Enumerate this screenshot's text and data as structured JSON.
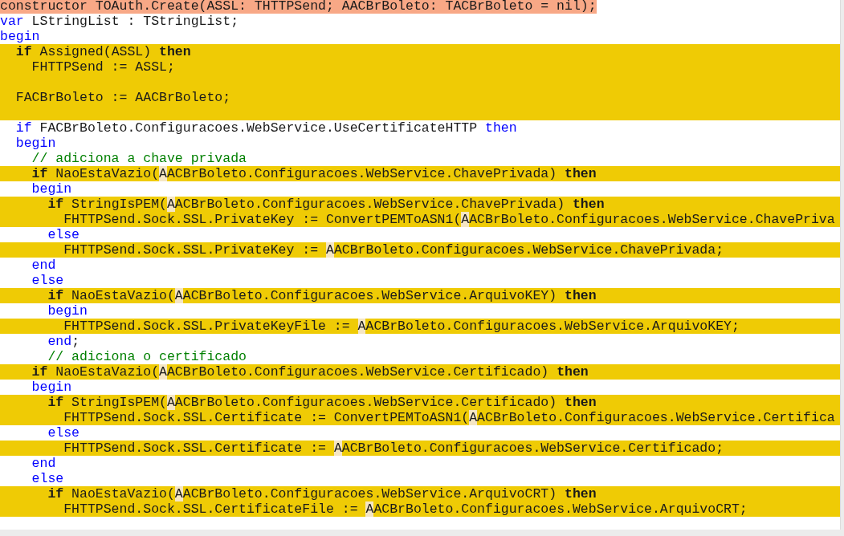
{
  "code_lines": [
    {
      "kind": "changed",
      "segments": [
        {
          "kind": "text",
          "text": "constructor TOAuth.Create(ASSL: THTTPSend; AACBrBoleto: TACBrBoleto = nil);"
        }
      ]
    },
    {
      "kind": "plain",
      "segments": [
        {
          "kind": "keyword",
          "text": "var"
        },
        {
          "kind": "text",
          "text": " LStringList : TStringList;"
        }
      ]
    },
    {
      "kind": "plain",
      "segments": [
        {
          "kind": "keyword",
          "text": "begin"
        }
      ]
    },
    {
      "kind": "added",
      "segments": [
        {
          "kind": "keyword",
          "text": "  if"
        },
        {
          "kind": "text",
          "text": " Assigned(ASSL) "
        },
        {
          "kind": "keyword",
          "text": "then"
        }
      ]
    },
    {
      "kind": "added",
      "segments": [
        {
          "kind": "text",
          "text": "    FHTTPSend := ASSL;"
        }
      ]
    },
    {
      "kind": "added"
    },
    {
      "kind": "added",
      "segments": [
        {
          "kind": "text",
          "text": "  FACBrBoleto := AACBrBoleto;"
        }
      ]
    },
    {
      "kind": "added"
    },
    {
      "kind": "plain",
      "segments": [
        {
          "kind": "keyword",
          "text": "  if"
        },
        {
          "kind": "text",
          "text": " FACBrBoleto.Configuracoes.WebService.UseCertificateHTTP "
        },
        {
          "kind": "keyword",
          "text": "then"
        }
      ]
    },
    {
      "kind": "plain",
      "segments": [
        {
          "kind": "keyword",
          "text": "  begin"
        }
      ]
    },
    {
      "kind": "plain",
      "segments": [
        {
          "kind": "comment",
          "text": "    // adiciona a chave privada"
        }
      ]
    },
    {
      "kind": "added",
      "segments": [
        {
          "kind": "keyword",
          "text": "    if"
        },
        {
          "kind": "text",
          "text": " NaoEstaVazio("
        },
        {
          "kind": "mark",
          "text": "A"
        },
        {
          "kind": "text",
          "text": "ACBrBoleto.Configuracoes.WebService.ChavePrivada) "
        },
        {
          "kind": "keyword",
          "text": "then"
        }
      ]
    },
    {
      "kind": "plain",
      "segments": [
        {
          "kind": "keyword",
          "text": "    begin"
        }
      ]
    },
    {
      "kind": "added",
      "segments": [
        {
          "kind": "keyword",
          "text": "      if"
        },
        {
          "kind": "text",
          "text": " StringIsPEM("
        },
        {
          "kind": "mark",
          "text": "A"
        },
        {
          "kind": "text",
          "text": "ACBrBoleto.Configuracoes.WebService.ChavePrivada) "
        },
        {
          "kind": "keyword",
          "text": "then"
        }
      ]
    },
    {
      "kind": "added",
      "segments": [
        {
          "kind": "text",
          "text": "        FHTTPSend.Sock.SSL.PrivateKey := ConvertPEMToASN1("
        },
        {
          "kind": "mark",
          "text": "A"
        },
        {
          "kind": "text",
          "text": "ACBrBoleto.Configuracoes.WebService.ChavePriva"
        }
      ]
    },
    {
      "kind": "plain",
      "segments": [
        {
          "kind": "keyword",
          "text": "      else"
        }
      ]
    },
    {
      "kind": "added",
      "segments": [
        {
          "kind": "text",
          "text": "        FHTTPSend.Sock.SSL.PrivateKey := "
        },
        {
          "kind": "mark",
          "text": "A"
        },
        {
          "kind": "text",
          "text": "ACBrBoleto.Configuracoes.WebService.ChavePrivada;"
        }
      ]
    },
    {
      "kind": "plain",
      "segments": [
        {
          "kind": "keyword",
          "text": "    end"
        }
      ]
    },
    {
      "kind": "plain",
      "segments": [
        {
          "kind": "keyword",
          "text": "    else"
        }
      ]
    },
    {
      "kind": "added",
      "segments": [
        {
          "kind": "keyword",
          "text": "      if"
        },
        {
          "kind": "text",
          "text": " NaoEstaVazio("
        },
        {
          "kind": "mark",
          "text": "A"
        },
        {
          "kind": "text",
          "text": "ACBrBoleto.Configuracoes.WebService.ArquivoKEY) "
        },
        {
          "kind": "keyword",
          "text": "then"
        }
      ]
    },
    {
      "kind": "plain",
      "segments": [
        {
          "kind": "keyword",
          "text": "      begin"
        }
      ]
    },
    {
      "kind": "added",
      "segments": [
        {
          "kind": "text",
          "text": "        FHTTPSend.Sock.SSL.PrivateKeyFile := "
        },
        {
          "kind": "mark",
          "text": "A"
        },
        {
          "kind": "text",
          "text": "ACBrBoleto.Configuracoes.WebService.ArquivoKEY;"
        }
      ]
    },
    {
      "kind": "plain",
      "segments": [
        {
          "kind": "keyword",
          "text": "      end"
        },
        {
          "kind": "text",
          "text": ";"
        }
      ]
    },
    {
      "kind": "plain",
      "segments": [
        {
          "kind": "comment",
          "text": "      // adiciona o certificado"
        }
      ]
    },
    {
      "kind": "added",
      "segments": [
        {
          "kind": "keyword",
          "text": "    if"
        },
        {
          "kind": "text",
          "text": " NaoEstaVazio("
        },
        {
          "kind": "mark",
          "text": "A"
        },
        {
          "kind": "text",
          "text": "ACBrBoleto.Configuracoes.WebService.Certificado) "
        },
        {
          "kind": "keyword",
          "text": "then"
        }
      ]
    },
    {
      "kind": "plain",
      "segments": [
        {
          "kind": "keyword",
          "text": "    begin"
        }
      ]
    },
    {
      "kind": "added",
      "segments": [
        {
          "kind": "keyword",
          "text": "      if"
        },
        {
          "kind": "text",
          "text": " StringIsPEM("
        },
        {
          "kind": "mark",
          "text": "A"
        },
        {
          "kind": "text",
          "text": "ACBrBoleto.Configuracoes.WebService.Certificado) "
        },
        {
          "kind": "keyword",
          "text": "then"
        }
      ]
    },
    {
      "kind": "added",
      "segments": [
        {
          "kind": "text",
          "text": "        FHTTPSend.Sock.SSL.Certificate := ConvertPEMToASN1("
        },
        {
          "kind": "mark",
          "text": "A"
        },
        {
          "kind": "text",
          "text": "ACBrBoleto.Configuracoes.WebService.Certifica"
        }
      ]
    },
    {
      "kind": "plain",
      "segments": [
        {
          "kind": "keyword",
          "text": "      else"
        }
      ]
    },
    {
      "kind": "added",
      "segments": [
        {
          "kind": "text",
          "text": "        FHTTPSend.Sock.SSL.Certificate := "
        },
        {
          "kind": "mark",
          "text": "A"
        },
        {
          "kind": "text",
          "text": "ACBrBoleto.Configuracoes.WebService.Certificado;"
        }
      ]
    },
    {
      "kind": "plain",
      "segments": [
        {
          "kind": "keyword",
          "text": "    end"
        }
      ]
    },
    {
      "kind": "plain",
      "segments": [
        {
          "kind": "keyword",
          "text": "    else"
        }
      ]
    },
    {
      "kind": "added",
      "segments": [
        {
          "kind": "keyword",
          "text": "      if"
        },
        {
          "kind": "text",
          "text": " NaoEstaVazio("
        },
        {
          "kind": "mark",
          "text": "A"
        },
        {
          "kind": "text",
          "text": "ACBrBoleto.Configuracoes.WebService.ArquivoCRT) "
        },
        {
          "kind": "keyword",
          "text": "then"
        }
      ]
    },
    {
      "kind": "added",
      "segments": [
        {
          "kind": "text",
          "text": "        FHTTPSend.Sock.SSL.CertificateFile := "
        },
        {
          "kind": "mark",
          "text": "A"
        },
        {
          "kind": "text",
          "text": "ACBrBoleto.Configuracoes.WebService.ArquivoCRT;"
        }
      ]
    }
  ]
}
